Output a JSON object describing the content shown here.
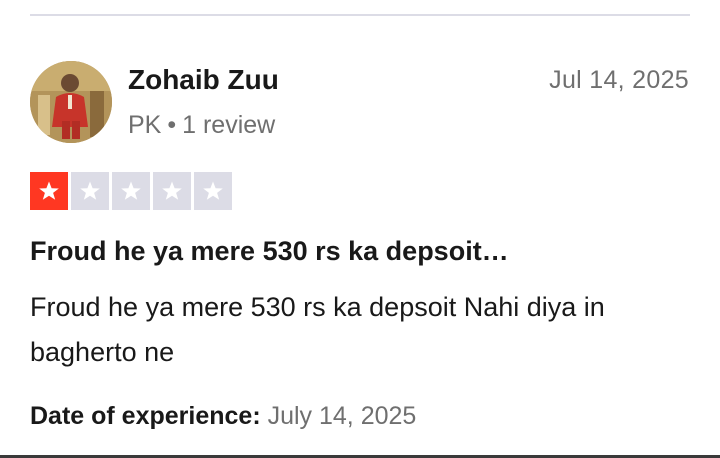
{
  "review": {
    "reviewer": {
      "name": "Zohaib Zuu",
      "country": "PK",
      "separator": "•",
      "review_count": "1 review"
    },
    "date": "Jul 14, 2025",
    "rating": 1,
    "rating_max": 5,
    "colors": {
      "star_filled": "#ff3722",
      "star_empty": "#dcdce6",
      "star_glyph": "#ffffff"
    },
    "title": "Froud he ya mere 530 rs ka depsoit…",
    "body": "Froud he ya mere 530 rs ka depsoit Nahi diya in bagherto ne",
    "experience_label": "Date of experience:",
    "experience_date": "July 14, 2025"
  }
}
